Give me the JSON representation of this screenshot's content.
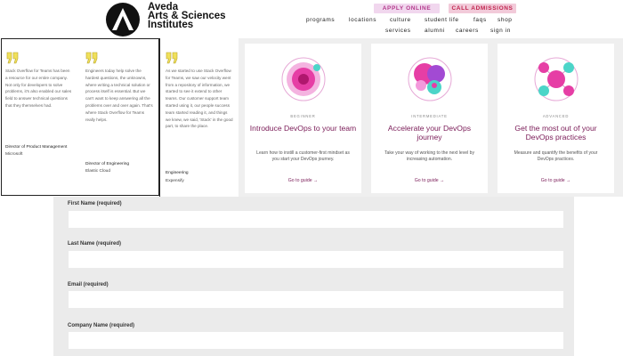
{
  "header": {
    "brand_lines": [
      "Aveda",
      "Arts & Sciences",
      "Institutes"
    ],
    "apply_label": "APPLY ONLINE",
    "call_label": "CALL ADMISSIONS",
    "nav_row1": [
      "programs",
      "locations",
      "culture",
      "student life",
      "faqs",
      "shop"
    ],
    "nav_row2": [
      "services",
      "alumni",
      "careers",
      "sign in"
    ],
    "colors": {
      "apply_bg": "#f1d7ee",
      "call_bg": "#f2cad9",
      "accent": "#b33a8c"
    }
  },
  "testimonials": [
    {
      "icon": "quote-icon",
      "quote": "Stack Overflow for Teams has been a resource for our entire company. Not only for developers to solve problems, it's also enabled our sales field to answer technical questions that they themselves had.",
      "role": "Director of Product Management",
      "company": "Microsoft"
    },
    {
      "icon": "quote-icon",
      "quote": "Engineers today help solve the hardest questions, the unknowns, where writing a technical solution or process itself is essential. But we can't want to keep answering all the problems over and over again. That's where Stack Overflow for Teams really helps.",
      "role": "Director of Engineering",
      "company": "Elastic Cloud"
    },
    {
      "icon": "quote-icon",
      "quote": "As we started to use Stack Overflow for Teams, we saw our velocity went from a repository of information, we started to see it extend to other teams. Our customer support team started using it, our people success team started reading it, and things we knew, we said, 'Stack' in the good part, to share the place.",
      "role": "Engineering",
      "company": "Expensify"
    }
  ],
  "cards": [
    {
      "level": "BEGINNER",
      "title": "Introduce DevOps to your team",
      "desc": "Learn how to instill a customer-first mindset as you start your DevOps journey.",
      "link": "Go to guide →"
    },
    {
      "level": "INTERMEDIATE",
      "title": "Accelerate your DevOps journey",
      "desc": "Take your way of working to the next level by increasing automation.",
      "link": "Go to guide →"
    },
    {
      "level": "ADVANCED",
      "title": "Get the most out of your DevOps practices",
      "desc": "Measure and quantify the benefits of your DevOps practices.",
      "link": "Go to guide →"
    }
  ],
  "form": {
    "fields": [
      {
        "label": "First Name (required)",
        "value": ""
      },
      {
        "label": "Last Name (required)",
        "value": ""
      },
      {
        "label": "Email (required)",
        "value": ""
      },
      {
        "label": "Company Name (required)",
        "value": ""
      }
    ]
  }
}
